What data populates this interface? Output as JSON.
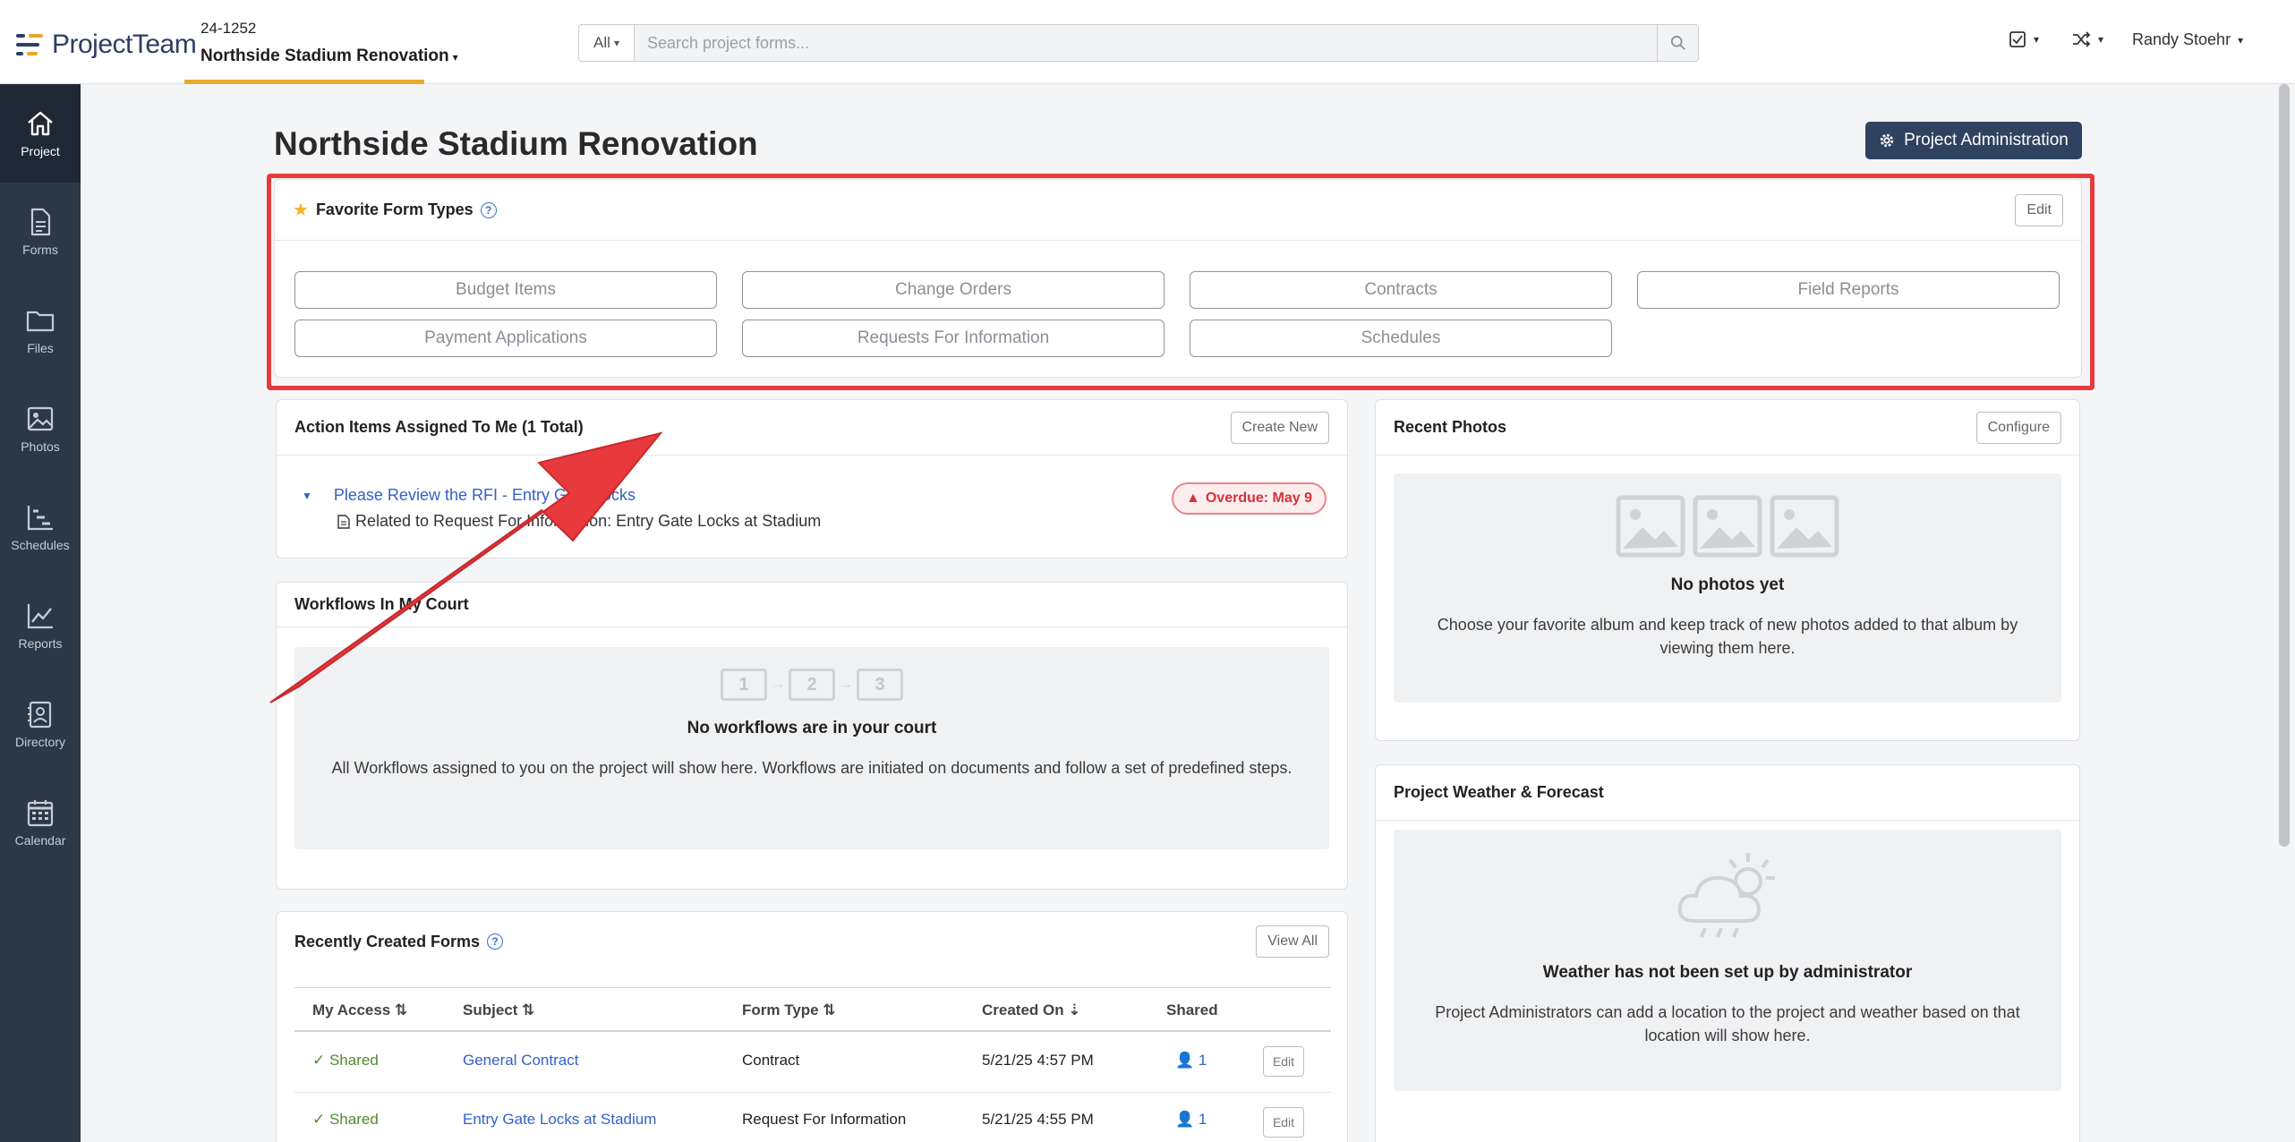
{
  "brand": {
    "name": "ProjectTeam"
  },
  "project": {
    "code": "24-1252",
    "name": "Northside Stadium Renovation"
  },
  "search": {
    "scope": "All",
    "placeholder": "Search project forms..."
  },
  "user": {
    "name": "Randy Stoehr"
  },
  "sidebar": {
    "items": [
      {
        "label": "Project",
        "icon": "home-icon"
      },
      {
        "label": "Forms",
        "icon": "document-icon"
      },
      {
        "label": "Files",
        "icon": "folder-icon"
      },
      {
        "label": "Photos",
        "icon": "image-icon"
      },
      {
        "label": "Schedules",
        "icon": "gantt-icon"
      },
      {
        "label": "Reports",
        "icon": "chart-icon"
      },
      {
        "label": "Directory",
        "icon": "contact-icon"
      },
      {
        "label": "Calendar",
        "icon": "calendar-icon"
      }
    ]
  },
  "page": {
    "title": "Northside Stadium Renovation",
    "admin_button": "Project Administration"
  },
  "favorites": {
    "title": "Favorite Form Types",
    "edit": "Edit",
    "items": [
      "Budget Items",
      "Change Orders",
      "Contracts",
      "Field Reports",
      "Payment Applications",
      "Requests For Information",
      "Schedules"
    ]
  },
  "action_items": {
    "title": "Action Items Assigned To Me (1 Total)",
    "create": "Create New",
    "item_title": "Please Review the RFI - Entry Gate Locks",
    "item_related": "Related to Request For Information: Entry Gate Locks at Stadium",
    "overdue": "Overdue: May 9"
  },
  "workflows": {
    "title": "Workflows In My Court",
    "steps": [
      "1",
      "2",
      "3"
    ],
    "empty_title": "No workflows are in your court",
    "empty_text": "All Workflows assigned to you on the project will show here. Workflows are initiated on documents and follow a set of predefined steps."
  },
  "recent_forms": {
    "title": "Recently Created Forms",
    "view_all": "View All",
    "columns": [
      "My Access",
      "Subject",
      "Form Type",
      "Created On",
      "Shared"
    ],
    "rows": [
      {
        "access": "Shared",
        "subject": "General Contract",
        "type": "Contract",
        "created": "5/21/25 4:57 PM",
        "shared": "1",
        "edit": "Edit"
      },
      {
        "access": "Shared",
        "subject": "Entry Gate Locks at Stadium",
        "type": "Request For Information",
        "created": "5/21/25 4:55 PM",
        "shared": "1",
        "edit": "Edit"
      }
    ]
  },
  "photos": {
    "title": "Recent Photos",
    "configure": "Configure",
    "empty_title": "No photos yet",
    "empty_text": "Choose your favorite album and keep track of new photos added to that album by viewing them here."
  },
  "weather": {
    "title": "Project Weather & Forecast",
    "empty_title": "Weather has not been set up by administrator",
    "empty_text": "Project Administrators can add a location to the project and weather based on that location will show here."
  },
  "colors": {
    "accent": "#e7ac2f",
    "sidebar": "#2d3847",
    "admin_button": "#2f4260",
    "highlight": "#e53b3e",
    "link": "#3560c9"
  }
}
